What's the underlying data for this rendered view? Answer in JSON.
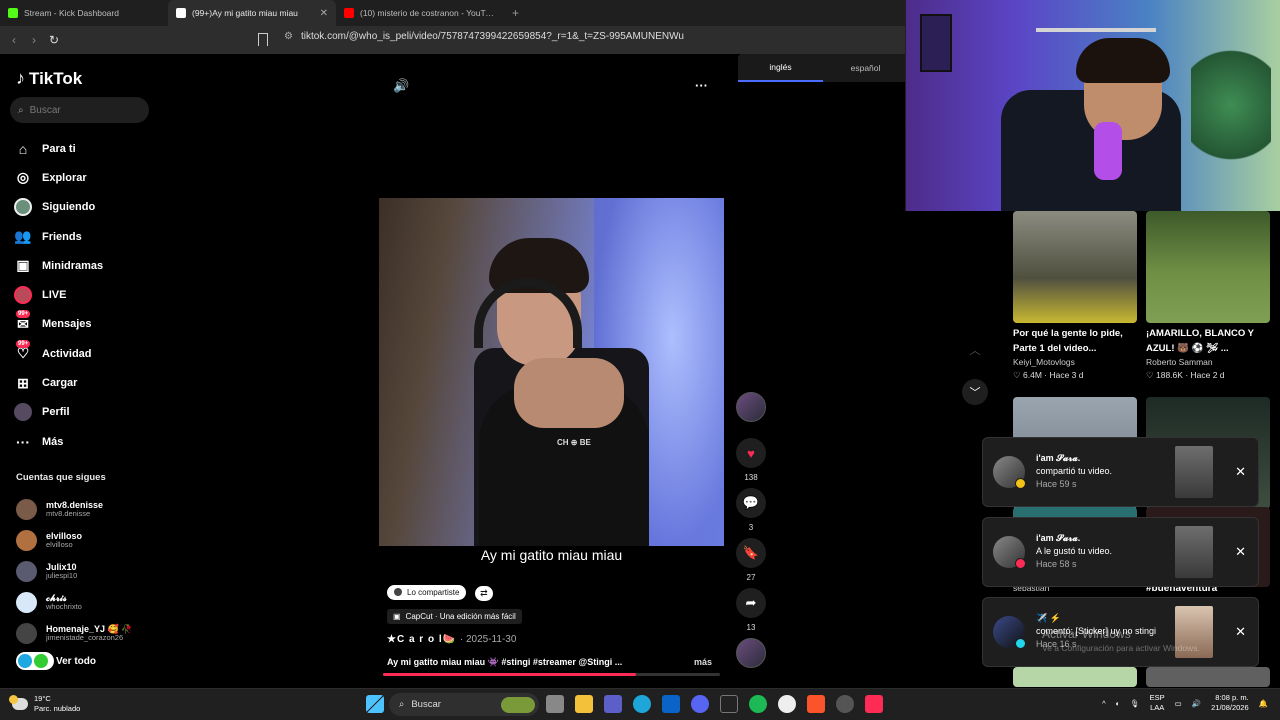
{
  "browser": {
    "tabs": [
      {
        "title": "Stream - Kick Dashboard",
        "color": "#53fc18"
      },
      {
        "title": "(99+)Ay mi gatito miau miau",
        "color": "#ffffff"
      },
      {
        "title": "(10) misterio de costranon - YouTube",
        "color": "#ff0000"
      }
    ],
    "url": "tiktok.com/@who_is_peli/video/7578747399422659854?_r=1&_t=ZS-995AMUNENWu"
  },
  "sidebar": {
    "logo": "TikTok",
    "search_placeholder": "Buscar",
    "nav": [
      {
        "label": "Para ti",
        "icon": "home-icon"
      },
      {
        "label": "Explorar",
        "icon": "compass-icon"
      },
      {
        "label": "Siguiendo",
        "icon": "following-avatar-icon"
      },
      {
        "label": "Friends",
        "icon": "friends-icon"
      },
      {
        "label": "Minidramas",
        "icon": "film-icon"
      },
      {
        "label": "LIVE",
        "icon": "live-icon"
      },
      {
        "label": "Mensajes",
        "icon": "message-icon",
        "badge": "99+"
      },
      {
        "label": "Actividad",
        "icon": "activity-icon",
        "badge": "99+"
      },
      {
        "label": "Cargar",
        "icon": "upload-icon"
      },
      {
        "label": "Perfil",
        "icon": "profile-icon"
      },
      {
        "label": "Más",
        "icon": "more-icon"
      }
    ],
    "following_title": "Cuentas que sigues",
    "following": [
      {
        "name": "mtv8.denisse",
        "handle": "mtv8.denisse",
        "color": "#7a5a48"
      },
      {
        "name": "elvilloso",
        "handle": "elvilloso",
        "color": "#b07040"
      },
      {
        "name": "Julix10",
        "handle": "juliespi10",
        "color": "#5a5a70"
      },
      {
        "name": "𝓬𝓱𝓻𝓲𝓼",
        "handle": "whochrixto",
        "color": "#d8e8f8"
      },
      {
        "name": "Homenaje_YJ 🥰 🥀",
        "handle": "jimenistade_corazon26",
        "color": "#444"
      }
    ],
    "see_all": "Ver todo"
  },
  "video": {
    "caption": "Ay mi gatito miau miau",
    "shared_pill": "Lo compartiste",
    "capcut": "CapCut · Una edición más fácil",
    "author": "★C a r o l🍉",
    "date": "· 2025-11-30",
    "description": "Ay mi gatito miau miau 👾 #stingi #streamer @Stingi ...",
    "more": "más",
    "progress": 0.75,
    "shirt_text": "CH ⊕ BE",
    "actions": {
      "likes": "138",
      "comments": "3",
      "saves": "27",
      "shares": "13"
    }
  },
  "translate": {
    "left": "inglés",
    "right": "español"
  },
  "recommended": [
    {
      "title": "Por qué la gente lo pide, Parte 1 del video...",
      "author": "Keiyi_Motovlogs",
      "likes": "6.4M",
      "time": "Hace 3 d",
      "thumb": "#6b7355"
    },
    {
      "title": "¡AMARILLO, BLANCO Y AZUL! 🐻 ⚽ 🛩 ...",
      "author": "Roberto Samman",
      "likes": "188.6K",
      "time": "Hace 2 d",
      "thumb": "#577a3c"
    }
  ],
  "partial_labels": {
    "left": "sebastian",
    "right": "#buenaventura"
  },
  "notifications": [
    {
      "name": "i'am 𝓢𝓪𝓻𝓪.",
      "action": "compartió tu video.",
      "time": "Hace 59 s",
      "badge_color": "#f2c218"
    },
    {
      "name": "i'am 𝓢𝓪𝓻𝓪.",
      "action": "A le gustó tu video.",
      "time": "Hace 58 s",
      "badge_color": "#fe2c55"
    },
    {
      "name": "✈️ ⚡",
      "action": "comentó: [Sticker] uy no stingi",
      "time": "Hace 16 s",
      "badge_color": "#20d5ec"
    }
  ],
  "watermark": {
    "title": "Activar Windows",
    "sub": "Ve a Configuración para activar Windows."
  },
  "taskbar": {
    "temp": "19°C",
    "weather": "Parc. nublado",
    "search": "Buscar",
    "lang1": "ESP",
    "lang2": "LAA",
    "time": "8:08 p. m.",
    "date": "21/08/2026"
  }
}
